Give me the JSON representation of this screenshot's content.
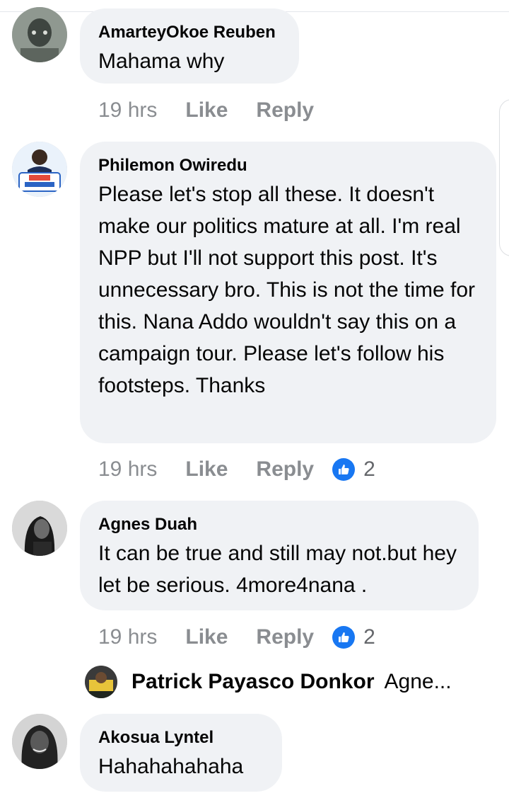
{
  "comments": [
    {
      "author": "AmarteyOkoe Reuben",
      "text": "Mahama why",
      "time": "19 hrs",
      "like_label": "Like",
      "reply_label": "Reply",
      "avatar_icon": "user-avatar-photo"
    },
    {
      "author": "Philemon Owiredu",
      "text": "Please let's stop all these. It doesn't make our politics mature at all. I'm real NPP but I'll not support this post. It's unnecessary bro. This is not the time for this. Nana Addo wouldn't say this on a campaign tour. Please let's follow his footsteps. Thanks",
      "time": "19 hrs",
      "like_label": "Like",
      "reply_label": "Reply",
      "reaction_count": "2",
      "avatar_icon": "user-avatar-photo"
    },
    {
      "author": "Agnes Duah",
      "text": "It can be true and still may not.but hey let be serious. 4more4nana .",
      "time": "19 hrs",
      "like_label": "Like",
      "reply_label": "Reply",
      "reaction_count": "2",
      "avatar_icon": "user-avatar-photo"
    },
    {
      "author": "Akosua Lyntel",
      "text": "Hahahahahaha",
      "avatar_icon": "user-avatar-photo"
    }
  ],
  "reply_preview": {
    "author": "Patrick Payasco Donkor",
    "snippet": "Agne...",
    "avatar_icon": "user-avatar-photo"
  },
  "colors": {
    "bubble": "#f0f2f5",
    "meta_text": "#8a8d91",
    "like_blue": "#1877f2",
    "text": "#050505"
  }
}
